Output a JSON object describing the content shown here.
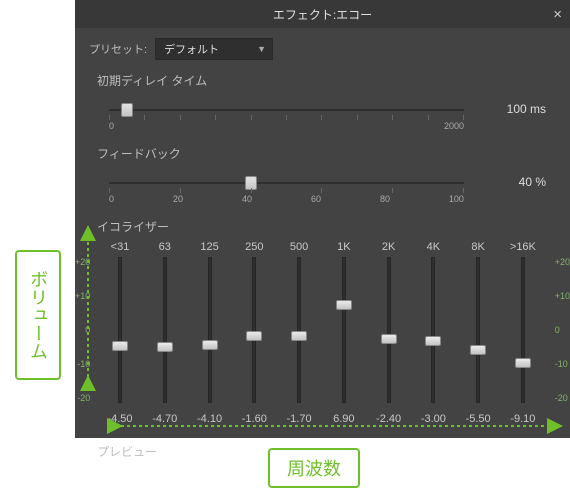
{
  "panel": {
    "title": "エフェクト:エコー",
    "preset_label": "プリセット:",
    "preset_value": "デフォルト",
    "close_glyph": "×"
  },
  "delay": {
    "label": "初期ディレイ タイム",
    "value_text": "100 ms",
    "min": 0,
    "max": 2000,
    "value": 100,
    "ticks": [
      "0",
      "",
      "",
      "",
      "",
      "",
      "",
      "",
      "",
      "",
      ""
    ],
    "scale_labels": [
      "0",
      "2000"
    ]
  },
  "feedback": {
    "label": "フィードバック",
    "value_text": "40 %",
    "min": 0,
    "max": 100,
    "value": 40,
    "ticks": [
      "0",
      "20",
      "40",
      "60",
      "80",
      "100"
    ]
  },
  "eq": {
    "label": "イコライザー",
    "freqs": [
      "<31",
      "63",
      "125",
      "250",
      "500",
      "1K",
      "2K",
      "4K",
      "8K",
      ">16K"
    ],
    "min": -20,
    "max": 20,
    "scale": [
      "+20",
      "+10",
      "0",
      "-10",
      "-20"
    ],
    "values": [
      -4.5,
      -4.7,
      -4.1,
      -1.6,
      -1.7,
      6.9,
      -2.4,
      -3.0,
      -5.5,
      -9.1
    ],
    "value_texts": [
      "-4.50",
      "-4.70",
      "-4.10",
      "-1.60",
      "-1.70",
      "6.90",
      "-2.40",
      "-3.00",
      "-5.50",
      "-9.10"
    ]
  },
  "preview_label": "プレビュー",
  "callouts": {
    "volume": "ボリューム",
    "freq": "周波数"
  }
}
